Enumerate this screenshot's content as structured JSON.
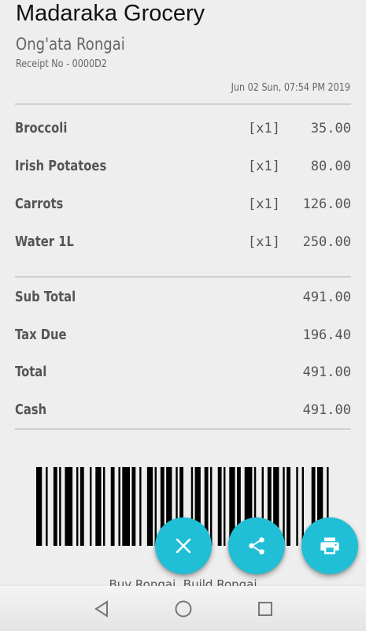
{
  "receipt": {
    "store_name": "Madaraka Grocery",
    "branch": "Ong'ata Rongai",
    "receipt_no": "Receipt No - 0000D2",
    "datetime": "Jun 02 Sun, 07:54 PM 2019"
  },
  "items": [
    {
      "name": "Broccoli",
      "qty": "[x1]",
      "amount": "35.00"
    },
    {
      "name": "Irish Potatoes",
      "qty": "[x1]",
      "amount": "80.00"
    },
    {
      "name": "Carrots",
      "qty": "[x1]",
      "amount": "126.00"
    },
    {
      "name": "Water 1L",
      "qty": "[x1]",
      "amount": "250.00"
    }
  ],
  "totals": [
    {
      "label": "Sub Total",
      "value": "491.00"
    },
    {
      "label": "Tax Due",
      "value": "196.40"
    },
    {
      "label": "Total",
      "value": "491.00"
    },
    {
      "label": "Cash",
      "value": "491.00"
    }
  ],
  "footer": {
    "slogan": "Buy Rongai. Build Rongai"
  },
  "actions": {
    "cancel_icon": "close-icon",
    "share_icon": "share-icon",
    "print_icon": "print-icon",
    "accent_color": "#21bfd6"
  },
  "nav": {
    "back_icon": "back-triangle-icon",
    "home_icon": "home-circle-icon",
    "recents_icon": "recents-square-icon"
  }
}
